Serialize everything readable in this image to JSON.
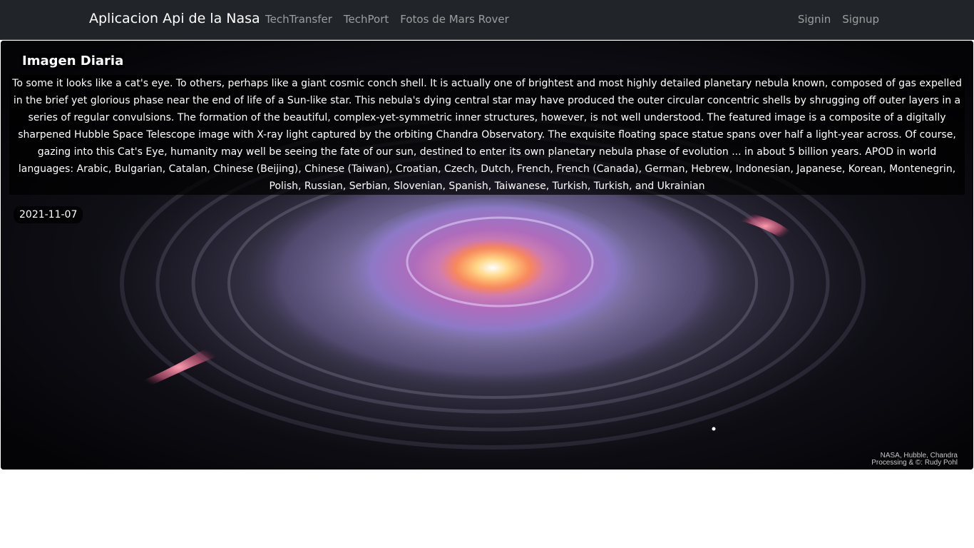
{
  "navbar": {
    "brand": "Aplicacion Api de la Nasa",
    "left_links": [
      "TechTransfer",
      "TechPort",
      "Fotos de Mars Rover"
    ],
    "right_links": [
      "Signin",
      "Signup"
    ]
  },
  "apod": {
    "title": "Imagen Diaria",
    "explanation": "To some it looks like a cat's eye. To others, perhaps like a giant cosmic conch shell. It is actually one of brightest and most highly detailed planetary nebula known, composed of gas expelled in the brief yet glorious phase near the end of life of a Sun-like star. This nebula's dying central star may have produced the outer circular concentric shells by shrugging off outer layers in a series of regular convulsions. The formation of the beautiful, complex-yet-symmetric inner structures, however, is not well understood. The featured image is a composite of a digitally sharpened Hubble Space Telescope image with X-ray light captured by the orbiting Chandra Observatory. The exquisite floating space statue spans over half a light-year across. Of course, gazing into this Cat's Eye, humanity may well be seeing the fate of our sun, destined to enter its own planetary nebula phase of evolution ... in about 5 billion years. APOD in world languages: Arabic, Bulgarian, Catalan, Chinese (Beijing), Chinese (Taiwan), Croatian, Czech, Dutch, French, French (Canada), German, Hebrew, Indonesian, Japanese, Korean, Montenegrin, Polish, Russian, Serbian, Slovenian, Spanish, Taiwanese, Turkish, Turkish, and Ukrainian",
    "date": "2021-11-07",
    "image_credit_line1": "NASA, Hubble, Chandra",
    "image_credit_line2": "Processing & ©: Rudy Pohl"
  },
  "colors": {
    "navbar_bg": "#212529",
    "nav_link": "rgba(255,255,255,0.55)",
    "brand": "#ffffff"
  }
}
